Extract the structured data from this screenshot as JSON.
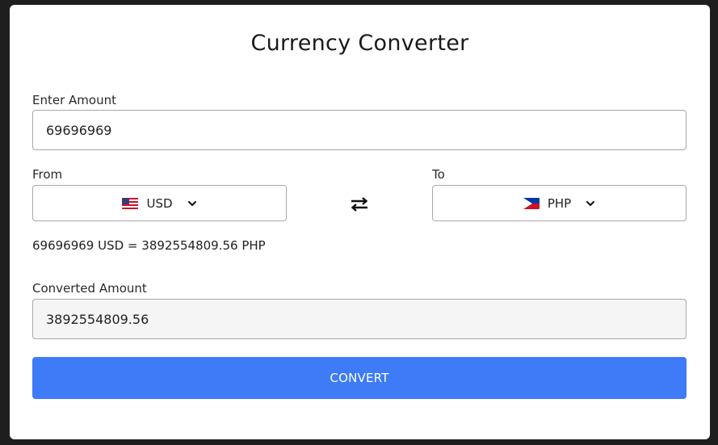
{
  "title": "Currency Converter",
  "amount": {
    "label": "Enter Amount",
    "value": "69696969"
  },
  "from": {
    "label": "From",
    "currency": "USD",
    "flag_icon": "us-flag-icon"
  },
  "to": {
    "label": "To",
    "currency": "PHP",
    "flag_icon": "ph-flag-icon"
  },
  "swap_icon": "swap-arrows-icon",
  "result_text": "69696969 USD = 3892554809.56 PHP",
  "converted": {
    "label": "Converted Amount",
    "value": "3892554809.56"
  },
  "convert_button": {
    "label": "CONVERT"
  },
  "colors": {
    "accent": "#3d7bf7",
    "background": "#1e1e1e",
    "card": "#ffffff"
  }
}
